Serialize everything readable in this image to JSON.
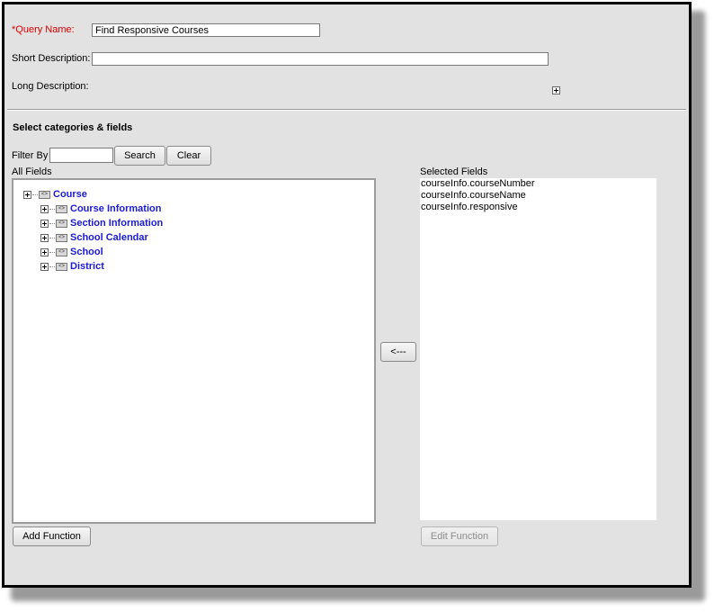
{
  "form": {
    "query_name_label": "*Query Name:",
    "query_name_value": "Find Responsive Courses",
    "short_description_label": "Short Description:",
    "short_description_value": "",
    "long_description_label": "Long Description:"
  },
  "categories": {
    "title": "Select categories & fields",
    "filter_label": "Filter By",
    "filter_value": "",
    "search_label": "Search",
    "clear_label": "Clear",
    "all_fields_label": "All Fields",
    "selected_fields_label": "Selected Fields",
    "remove_label": "<---",
    "add_function_label": "Add Function",
    "edit_function_label": "Edit Function"
  },
  "tree": {
    "root": "Course",
    "children": [
      "Course Information",
      "Section Information",
      "School Calendar",
      "School",
      "District"
    ]
  },
  "selected_fields": [
    "courseInfo.courseNumber",
    "courseInfo.courseName",
    "courseInfo.responsive"
  ],
  "colors": {
    "required": "#e00000",
    "tree_link": "#1a1adb",
    "background": "#e2e2e2"
  }
}
